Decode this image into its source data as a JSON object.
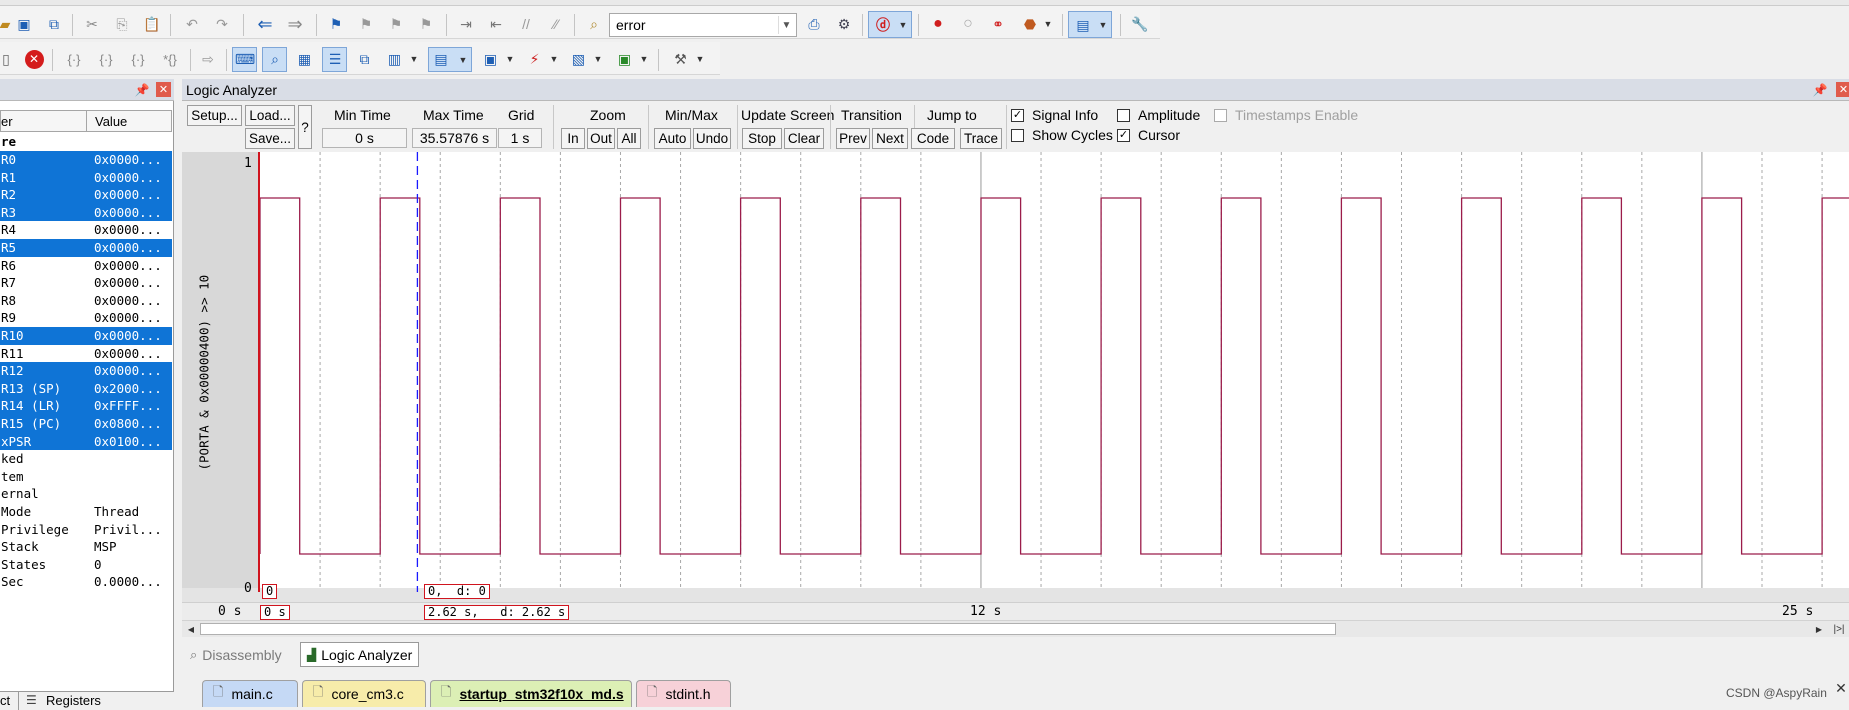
{
  "toolbar1": {
    "target_combo": "error"
  },
  "registers": {
    "col_name": "er",
    "col_value": "Value",
    "group_label": "re",
    "rows": [
      {
        "name": "R0",
        "value": "0x0000...",
        "sel": true
      },
      {
        "name": "R1",
        "value": "0x0000...",
        "sel": true
      },
      {
        "name": "R2",
        "value": "0x0000...",
        "sel": true
      },
      {
        "name": "R3",
        "value": "0x0000...",
        "sel": true
      },
      {
        "name": "R4",
        "value": "0x0000...",
        "sel": false
      },
      {
        "name": "R5",
        "value": "0x0000...",
        "sel": true
      },
      {
        "name": "R6",
        "value": "0x0000...",
        "sel": false
      },
      {
        "name": "R7",
        "value": "0x0000...",
        "sel": false
      },
      {
        "name": "R8",
        "value": "0x0000...",
        "sel": false
      },
      {
        "name": "R9",
        "value": "0x0000...",
        "sel": false
      },
      {
        "name": "R10",
        "value": "0x0000...",
        "sel": true
      },
      {
        "name": "R11",
        "value": "0x0000...",
        "sel": false
      },
      {
        "name": "R12",
        "value": "0x0000...",
        "sel": true
      },
      {
        "name": "R13 (SP)",
        "value": "0x2000...",
        "sel": true
      },
      {
        "name": "R14 (LR)",
        "value": "0xFFFF...",
        "sel": true
      },
      {
        "name": "R15 (PC)",
        "value": "0x0800...",
        "sel": true
      },
      {
        "name": "xPSR",
        "value": "0x0100...",
        "sel": true
      },
      {
        "name": "ked",
        "value": "",
        "sel": false
      },
      {
        "name": "tem",
        "value": "",
        "sel": false
      },
      {
        "name": "ernal",
        "value": "",
        "sel": false
      },
      {
        "name": "Mode",
        "value": "Thread",
        "sel": false
      },
      {
        "name": "Privilege",
        "value": "Privil...",
        "sel": false
      },
      {
        "name": "Stack",
        "value": "MSP",
        "sel": false
      },
      {
        "name": "States",
        "value": "0",
        "sel": false
      },
      {
        "name": "Sec",
        "value": "0.0000...",
        "sel": false
      }
    ],
    "tab_project": "ct",
    "tab_registers": "Registers"
  },
  "logic_analyzer": {
    "title": "Logic Analyzer",
    "setup_label": "Setup...",
    "load_label": "Load...",
    "save_label": "Save...",
    "help_label": "?",
    "min_time_label": "Min Time",
    "min_time_value": "0 s",
    "max_time_label": "Max Time",
    "max_time_value": "35.57876 s",
    "grid_label": "Grid",
    "grid_value": "1 s",
    "zoom_label": "Zoom",
    "zoom_in": "In",
    "zoom_out": "Out",
    "zoom_all": "All",
    "minmax_label": "Min/Max",
    "minmax_auto": "Auto",
    "minmax_undo": "Undo",
    "update_label": "Update Screen",
    "update_stop": "Stop",
    "update_clear": "Clear",
    "transition_label": "Transition",
    "transition_prev": "Prev",
    "transition_next": "Next",
    "jump_label": "Jump to",
    "jump_code": "Code",
    "jump_trace": "Trace",
    "opt_signal_info": "Signal Info",
    "opt_show_cycles": "Show Cycles",
    "opt_amplitude": "Amplitude",
    "opt_cursor": "Cursor",
    "opt_timestamps": "Timestamps Enable",
    "signal_info": true,
    "show_cycles": false,
    "amplitude": false,
    "cursor": true,
    "timestamps": false,
    "signal_name": "(PORTA & 0x00000400) >> 10",
    "y_top": "1",
    "y_bottom": "0",
    "marker_zero_value": "0",
    "marker_cursor_value": "0,  d: 0",
    "axis_start": "0 s",
    "axis_start_box": "0 s",
    "cursor_time_box": "2.62 s,   d: 2.62 s",
    "axis_mid": "12 s",
    "axis_end": "25 s",
    "tab_disassembly": "Disassembly",
    "tab_logic": "Logic Analyzer"
  },
  "waveform": {
    "period_s": 2.0,
    "high_duration_s": 0.66,
    "first_rise_s": 0.0,
    "view_start_s": 0,
    "view_end_s": 25,
    "cursor_s": 2.62,
    "line_color": "#9b1c4a",
    "cursor_color": "#1a1aff"
  },
  "file_tabs": [
    {
      "label": "main.c",
      "color": "#c5d9f5"
    },
    {
      "label": "core_cm3.c",
      "color": "#f7ecaa"
    },
    {
      "label": "startup_stm32f10x_md.s",
      "color": "#dcefb5"
    },
    {
      "label": "stdint.h",
      "color": "#f7d1d8"
    }
  ],
  "watermark": "CSDN @AspyRain"
}
